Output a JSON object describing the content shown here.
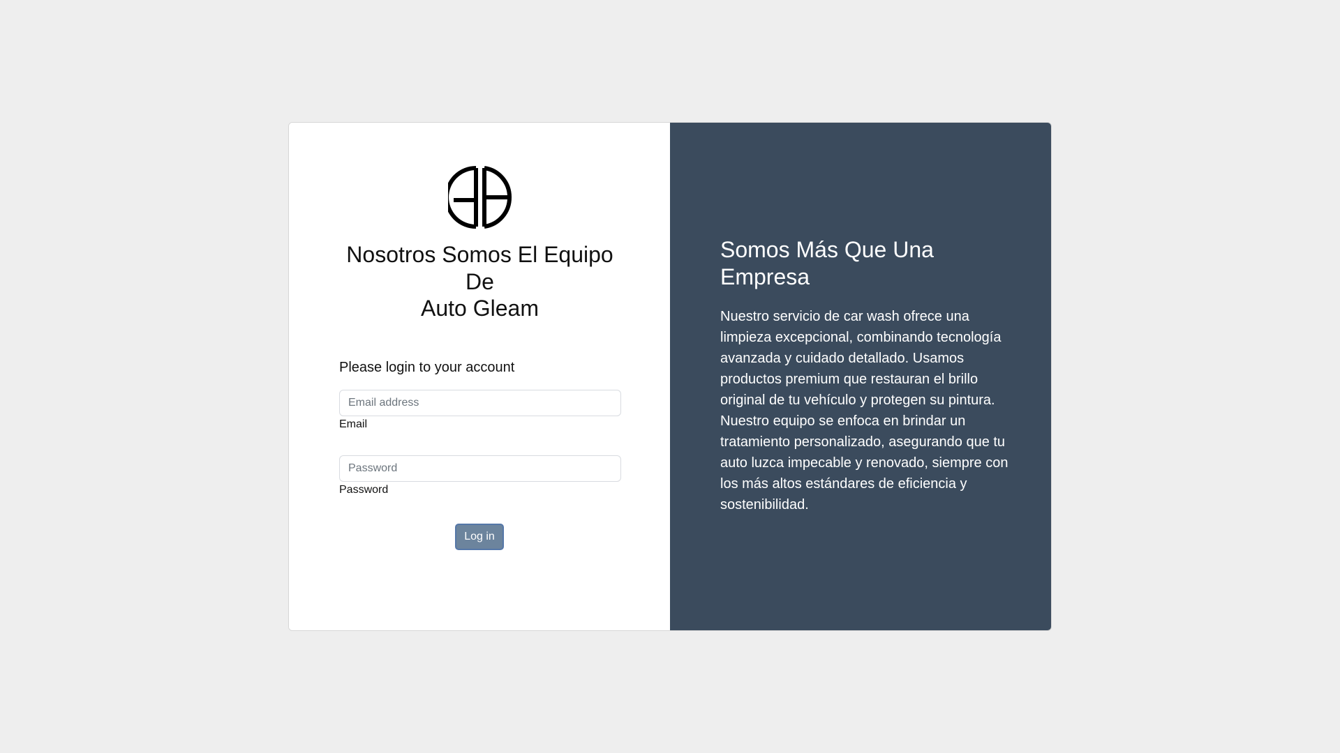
{
  "logo": {
    "text": "AG",
    "icon": "auto-gleam-logo"
  },
  "brand": {
    "title_lines": [
      "Nosotros Somos El Equipo",
      "De",
      "Auto Gleam"
    ]
  },
  "login": {
    "prompt": "Please login to your account",
    "email": {
      "placeholder": "Email address",
      "label": "Email"
    },
    "password": {
      "placeholder": "Password",
      "label": "Password"
    },
    "button_label": "Log in"
  },
  "promo": {
    "title": "Somos Más Que Una Empresa",
    "body": "Nuestro servicio de car wash ofrece una limpieza excepcional, combinando tecnología avanzada y cuidado detallado. Usamos productos premium que restauran el brillo original de tu vehículo y protegen su pintura. Nuestro equipo se enfoca en brindar un tratamiento personalizado, asegurando que tu auto luzca impecable y renovado, siempre con los más altos estándares de eficiencia y sostenibilidad."
  },
  "colors": {
    "page_background": "#eeeeee",
    "promo_panel": "#3b4b5d",
    "button": "#6c849d"
  }
}
